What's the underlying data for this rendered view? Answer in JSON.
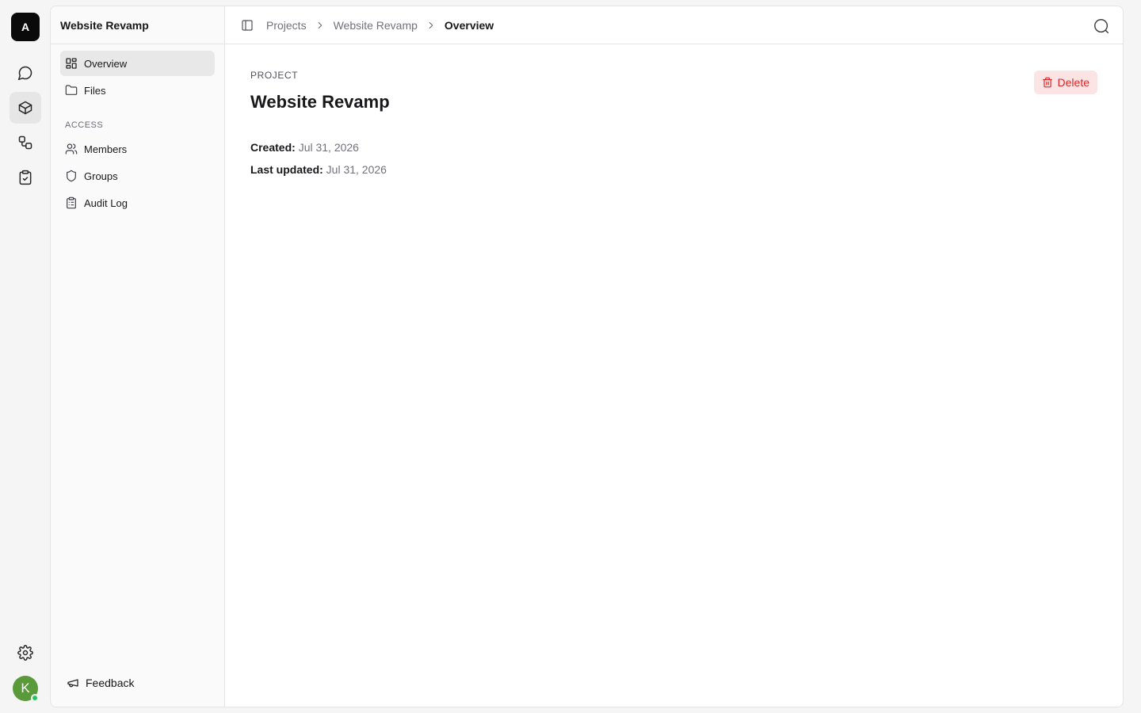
{
  "rail": {
    "logo_letter": "A",
    "items": [
      {
        "name": "chat",
        "icon": "message-circle-icon",
        "active": false
      },
      {
        "name": "projects",
        "icon": "box-icon",
        "active": true
      },
      {
        "name": "workflows",
        "icon": "workflow-icon",
        "active": false
      },
      {
        "name": "tasks",
        "icon": "clipboard-check-icon",
        "active": false
      }
    ],
    "settings_icon": "gear-icon",
    "avatar_letter": "K",
    "avatar_color": "#5a9a3a",
    "status_color": "#22c55e"
  },
  "sidebar": {
    "title": "Website Revamp",
    "primary": [
      {
        "label": "Overview",
        "icon": "layout-grid-icon",
        "active": true
      },
      {
        "label": "Files",
        "icon": "folder-icon",
        "active": false
      }
    ],
    "section_label": "ACCESS",
    "access": [
      {
        "label": "Members",
        "icon": "users-icon"
      },
      {
        "label": "Groups",
        "icon": "shield-icon"
      },
      {
        "label": "Audit Log",
        "icon": "clipboard-list-icon"
      }
    ],
    "feedback_label": "Feedback"
  },
  "breadcrumb": {
    "items": [
      "Projects",
      "Website Revamp",
      "Overview"
    ]
  },
  "page": {
    "eyebrow": "PROJECT",
    "title": "Website Revamp",
    "created_label": "Created:",
    "created_value": "Jul 31, 2026",
    "updated_label": "Last updated:",
    "updated_value": "Jul 31, 2026",
    "delete_label": "Delete"
  },
  "colors": {
    "delete_bg": "#fde4e4",
    "delete_fg": "#dc2626"
  }
}
